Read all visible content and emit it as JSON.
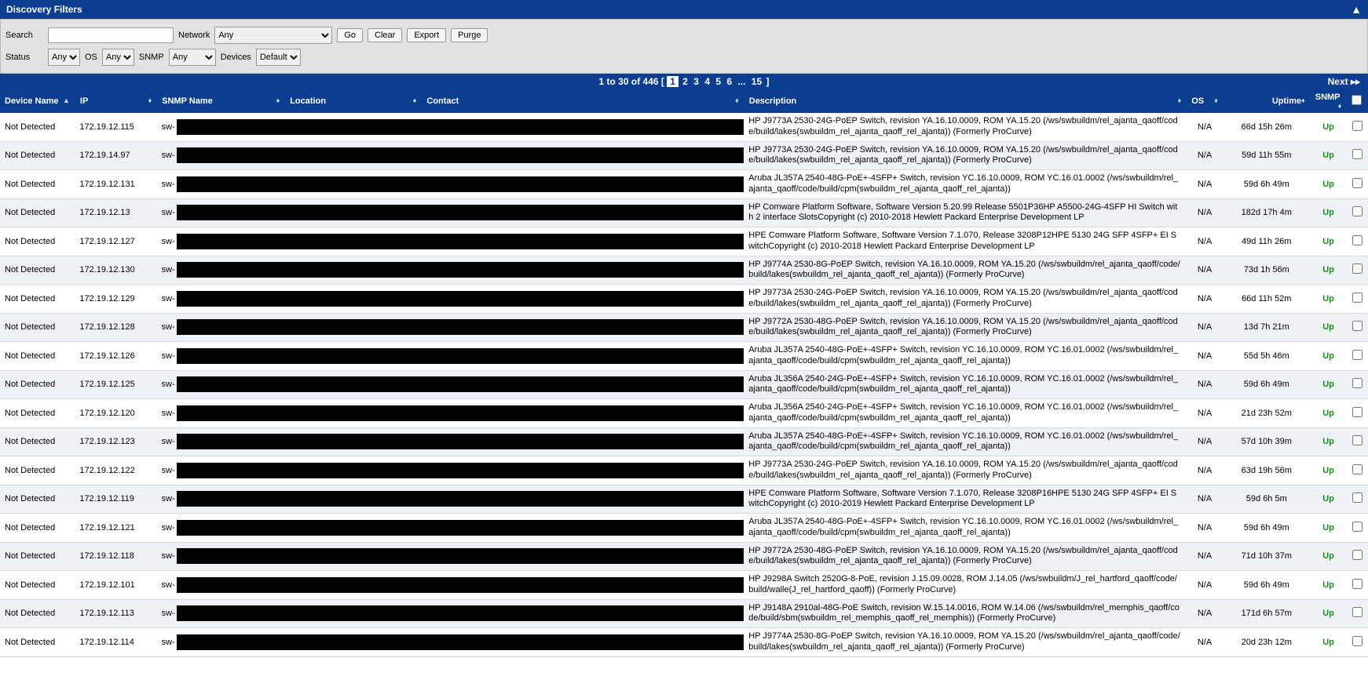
{
  "header": {
    "title": "Discovery Filters"
  },
  "filters": {
    "search_label": "Search",
    "search_value": "",
    "network_label": "Network",
    "network_value": "Any",
    "go": "Go",
    "clear": "Clear",
    "export": "Export",
    "purge": "Purge",
    "status_label": "Status",
    "status_value": "Any",
    "os_label": "OS",
    "os_value": "Any",
    "snmp_label": "SNMP",
    "snmp_value": "Any",
    "devices_label": "Devices",
    "devices_value": "Default"
  },
  "paging": {
    "range": "1 to 30 of 446",
    "pages": [
      "1",
      "2",
      "3",
      "4",
      "5",
      "6",
      "...",
      "15"
    ],
    "current": "1",
    "next": "Next ▸▸"
  },
  "columns": {
    "device": "Device Name",
    "ip": "IP",
    "snmp_name": "SNMP Name",
    "location": "Location",
    "contact": "Contact",
    "description": "Description",
    "os": "OS",
    "uptime": "Uptime",
    "snmp": "SNMP"
  },
  "rows": [
    {
      "dev": "Not Detected",
      "ip": "172.19.12.115",
      "sn": "sw-",
      "desc": "HP J9773A 2530-24G-PoEP Switch, revision YA.16.10.0009, ROM YA.15.20 (/ws/swbuildm/rel_ajanta_qaoff/code/build/lakes(swbuildm_rel_ajanta_qaoff_rel_ajanta)) (Formerly ProCurve)",
      "os": "N/A",
      "up": "66d 15h 26m",
      "snmp": "Up"
    },
    {
      "dev": "Not Detected",
      "ip": "172.19.14.97",
      "sn": "sw-",
      "desc": "HP J9773A 2530-24G-PoEP Switch, revision YA.16.10.0009, ROM YA.15.20 (/ws/swbuildm/rel_ajanta_qaoff/code/build/lakes(swbuildm_rel_ajanta_qaoff_rel_ajanta)) (Formerly ProCurve)",
      "os": "N/A",
      "up": "59d 11h 55m",
      "snmp": "Up"
    },
    {
      "dev": "Not Detected",
      "ip": "172.19.12.131",
      "sn": "sw-",
      "desc": "Aruba JL357A 2540-48G-PoE+-4SFP+ Switch, revision YC.16.10.0009, ROM YC.16.01.0002 (/ws/swbuildm/rel_ajanta_qaoff/code/build/cpm(swbuildm_rel_ajanta_qaoff_rel_ajanta))",
      "os": "N/A",
      "up": "59d 6h 49m",
      "snmp": "Up"
    },
    {
      "dev": "Not Detected",
      "ip": "172.19.12.13",
      "sn": "sw-",
      "desc": "HP Comware Platform Software, Software Version 5.20.99 Release 5501P36HP A5500-24G-4SFP HI Switch with 2 interface SlotsCopyright (c) 2010-2018 Hewlett Packard Enterprise Development LP",
      "os": "N/A",
      "up": "182d 17h 4m",
      "snmp": "Up"
    },
    {
      "dev": "Not Detected",
      "ip": "172.19.12.127",
      "sn": "sw-",
      "desc": "HPE Comware Platform Software, Software Version 7.1.070, Release 3208P12HPE 5130 24G SFP 4SFP+ EI SwitchCopyright (c) 2010-2018 Hewlett Packard Enterprise Development LP",
      "os": "N/A",
      "up": "49d 11h 26m",
      "snmp": "Up"
    },
    {
      "dev": "Not Detected",
      "ip": "172.19.12.130",
      "sn": "sw-",
      "desc": "HP J9774A 2530-8G-PoEP Switch, revision YA.16.10.0009, ROM YA.15.20 (/ws/swbuildm/rel_ajanta_qaoff/code/build/lakes(swbuildm_rel_ajanta_qaoff_rel_ajanta)) (Formerly ProCurve)",
      "os": "N/A",
      "up": "73d 1h 56m",
      "snmp": "Up"
    },
    {
      "dev": "Not Detected",
      "ip": "172.19.12.129",
      "sn": "sw-",
      "desc": "HP J9773A 2530-24G-PoEP Switch, revision YA.16.10.0009, ROM YA.15.20 (/ws/swbuildm/rel_ajanta_qaoff/code/build/lakes(swbuildm_rel_ajanta_qaoff_rel_ajanta)) (Formerly ProCurve)",
      "os": "N/A",
      "up": "66d 11h 52m",
      "snmp": "Up"
    },
    {
      "dev": "Not Detected",
      "ip": "172.19.12.128",
      "sn": "sw-",
      "desc": "HP J9772A 2530-48G-PoEP Switch, revision YA.16.10.0009, ROM YA.15.20 (/ws/swbuildm/rel_ajanta_qaoff/code/build/lakes(swbuildm_rel_ajanta_qaoff_rel_ajanta)) (Formerly ProCurve)",
      "os": "N/A",
      "up": "13d 7h 21m",
      "snmp": "Up"
    },
    {
      "dev": "Not Detected",
      "ip": "172.19.12.126",
      "sn": "sw-",
      "desc": "Aruba JL357A 2540-48G-PoE+-4SFP+ Switch, revision YC.16.10.0009, ROM YC.16.01.0002 (/ws/swbuildm/rel_ajanta_qaoff/code/build/cpm(swbuildm_rel_ajanta_qaoff_rel_ajanta))",
      "os": "N/A",
      "up": "55d 5h 46m",
      "snmp": "Up"
    },
    {
      "dev": "Not Detected",
      "ip": "172.19.12.125",
      "sn": "sw-",
      "desc": "Aruba JL356A 2540-24G-PoE+-4SFP+ Switch, revision YC.16.10.0009, ROM YC.16.01.0002 (/ws/swbuildm/rel_ajanta_qaoff/code/build/cpm(swbuildm_rel_ajanta_qaoff_rel_ajanta))",
      "os": "N/A",
      "up": "59d 6h 49m",
      "snmp": "Up"
    },
    {
      "dev": "Not Detected",
      "ip": "172.19.12.120",
      "sn": "sw-",
      "desc": "Aruba JL356A 2540-24G-PoE+-4SFP+ Switch, revision YC.16.10.0009, ROM YC.16.01.0002 (/ws/swbuildm/rel_ajanta_qaoff/code/build/cpm(swbuildm_rel_ajanta_qaoff_rel_ajanta))",
      "os": "N/A",
      "up": "21d 23h 52m",
      "snmp": "Up"
    },
    {
      "dev": "Not Detected",
      "ip": "172.19.12.123",
      "sn": "sw-",
      "desc": "Aruba JL357A 2540-48G-PoE+-4SFP+ Switch, revision YC.16.10.0009, ROM YC.16.01.0002 (/ws/swbuildm/rel_ajanta_qaoff/code/build/cpm(swbuildm_rel_ajanta_qaoff_rel_ajanta))",
      "os": "N/A",
      "up": "57d 10h 39m",
      "snmp": "Up"
    },
    {
      "dev": "Not Detected",
      "ip": "172.19.12.122",
      "sn": "sw-",
      "desc": "HP J9773A 2530-24G-PoEP Switch, revision YA.16.10.0009, ROM YA.15.20 (/ws/swbuildm/rel_ajanta_qaoff/code/build/lakes(swbuildm_rel_ajanta_qaoff_rel_ajanta)) (Formerly ProCurve)",
      "os": "N/A",
      "up": "63d 19h 56m",
      "snmp": "Up"
    },
    {
      "dev": "Not Detected",
      "ip": "172.19.12.119",
      "sn": "sw-",
      "desc": "HPE Comware Platform Software, Software Version 7.1.070, Release 3208P16HPE 5130 24G SFP 4SFP+ EI SwitchCopyright (c) 2010-2019 Hewlett Packard Enterprise Development LP",
      "os": "N/A",
      "up": "59d 6h 5m",
      "snmp": "Up"
    },
    {
      "dev": "Not Detected",
      "ip": "172.19.12.121",
      "sn": "sw-",
      "desc": "Aruba JL357A 2540-48G-PoE+-4SFP+ Switch, revision YC.16.10.0009, ROM YC.16.01.0002 (/ws/swbuildm/rel_ajanta_qaoff/code/build/cpm(swbuildm_rel_ajanta_qaoff_rel_ajanta))",
      "os": "N/A",
      "up": "59d 6h 49m",
      "snmp": "Up"
    },
    {
      "dev": "Not Detected",
      "ip": "172.19.12.118",
      "sn": "sw-",
      "desc": "HP J9772A 2530-48G-PoEP Switch, revision YA.16.10.0009, ROM YA.15.20 (/ws/swbuildm/rel_ajanta_qaoff/code/build/lakes(swbuildm_rel_ajanta_qaoff_rel_ajanta)) (Formerly ProCurve)",
      "os": "N/A",
      "up": "71d 10h 37m",
      "snmp": "Up"
    },
    {
      "dev": "Not Detected",
      "ip": "172.19.12.101",
      "sn": "sw-",
      "desc": "HP J9298A Switch 2520G-8-PoE, revision J.15.09.0028, ROM J.14.05 (/ws/swbuildm/J_rel_hartford_qaoff/code/build/walle(J_rel_hartford_qaoff)) (Formerly ProCurve)",
      "os": "N/A",
      "up": "59d 6h 49m",
      "snmp": "Up"
    },
    {
      "dev": "Not Detected",
      "ip": "172.19.12.113",
      "sn": "sw-",
      "desc": "HP J9148A 2910al-48G-PoE Switch, revision W.15.14.0016, ROM W.14.06 (/ws/swbuildm/rel_memphis_qaoff/code/build/sbm(swbuildm_rel_memphis_qaoff_rel_memphis)) (Formerly ProCurve)",
      "os": "N/A",
      "up": "171d 6h 57m",
      "snmp": "Up"
    },
    {
      "dev": "Not Detected",
      "ip": "172.19.12.114",
      "sn": "sw-",
      "desc": "HP J9774A 2530-8G-PoEP Switch, revision YA.16.10.0009, ROM YA.15.20 (/ws/swbuildm/rel_ajanta_qaoff/code/build/lakes(swbuildm_rel_ajanta_qaoff_rel_ajanta)) (Formerly ProCurve)",
      "os": "N/A",
      "up": "20d 23h 12m",
      "snmp": "Up"
    }
  ]
}
